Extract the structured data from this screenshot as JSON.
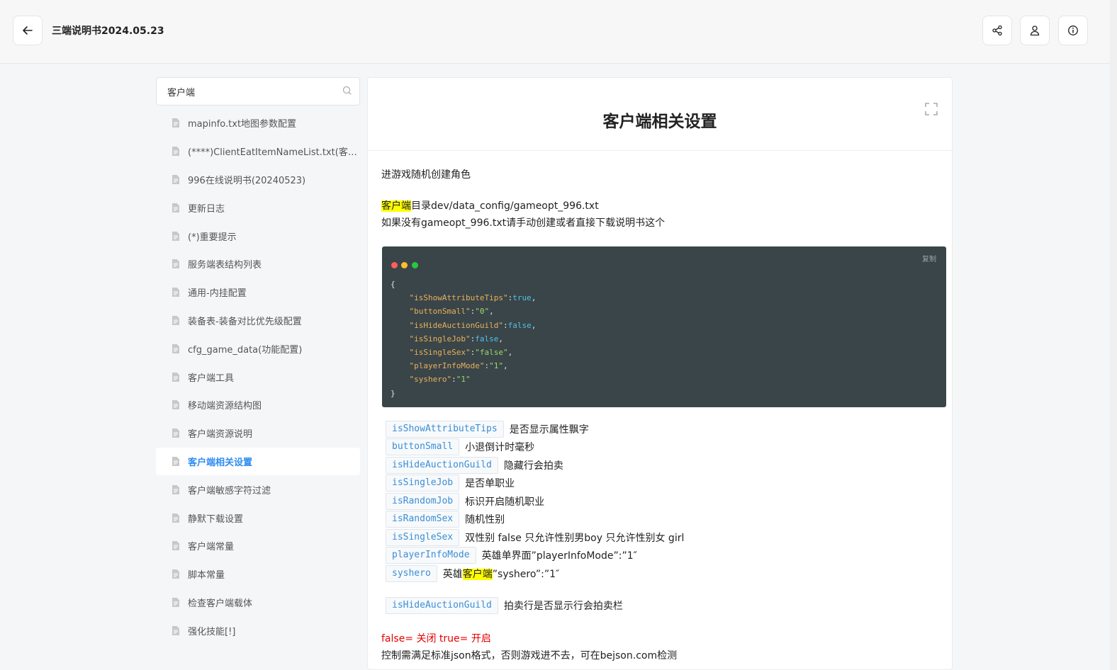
{
  "header": {
    "title": "三端说明书2024.05.23",
    "back_icon": "arrow-left-icon",
    "share_icon": "share-icon",
    "user_icon": "user-icon",
    "info_icon": "info-icon"
  },
  "sidebar": {
    "search_value": "客户端",
    "items": [
      {
        "label": "mapinfo.txt地图参数配置"
      },
      {
        "label": "(****)ClientEatItemNameList.txt(客户端"
      },
      {
        "label": "996在线说明书(20240523)"
      },
      {
        "label": "更新日志"
      },
      {
        "label": "(*)重要提示"
      },
      {
        "label": "服务端表结构列表"
      },
      {
        "label": "通用-内挂配置"
      },
      {
        "label": "装备表-装备对比优先级配置"
      },
      {
        "label": "cfg_game_data(功能配置)"
      },
      {
        "label": "客户端工具"
      },
      {
        "label": "移动端资源结构图"
      },
      {
        "label": "客户端资源说明"
      },
      {
        "label": "客户端相关设置",
        "active": true
      },
      {
        "label": "客户端敏感字符过滤"
      },
      {
        "label": "静默下载设置"
      },
      {
        "label": "客户端常量"
      },
      {
        "label": "脚本常量"
      },
      {
        "label": "检查客户端载体"
      },
      {
        "label": "强化技能[!]"
      }
    ]
  },
  "article": {
    "title": "客户端相关设置",
    "intro": "进游戏随机创建角色",
    "path_highlight": "客户端",
    "path_rest": "目录dev/data_config/gameopt_996.txt",
    "note": "如果没有gameopt_996.txt请手动创建或者直接下载说明书这个",
    "code": {
      "copy_label": "复制",
      "open_brace": "{",
      "close_brace": "}",
      "lines": [
        {
          "key": "\"isShowAttributeTips\"",
          "value": "true",
          "type": "bool"
        },
        {
          "key": "\"buttonSmall\"",
          "value": "\"0\"",
          "type": "str"
        },
        {
          "key": "\"isHideAuctionGuild\"",
          "value": "false",
          "type": "bool"
        },
        {
          "key": "\"isSingleJob\"",
          "value": "false",
          "type": "bool"
        },
        {
          "key": "\"isSingleSex\"",
          "value": "\"false\"",
          "type": "str"
        },
        {
          "key": "\"playerInfoMode\"",
          "value": "\"1\"",
          "type": "str"
        },
        {
          "key": "\"syshero\"",
          "value": "\"1\"",
          "type": "str",
          "last": true
        }
      ]
    },
    "params": [
      {
        "name": "isShowAttributeTips",
        "desc": "是否显示属性飘字"
      },
      {
        "name": "buttonSmall",
        "desc": "小退倒计时毫秒"
      },
      {
        "name": "isHideAuctionGuild",
        "desc": "隐藏行会拍卖"
      },
      {
        "name": "isSingleJob",
        "desc": "是否单职业"
      },
      {
        "name": "isRandomJob",
        "desc": "标识开启随机职业"
      },
      {
        "name": "isRandomSex",
        "desc": "随机性别"
      },
      {
        "name": "isSingleSex",
        "desc": "双性别 false 只允许性别男boy 只允许性别女 girl"
      },
      {
        "name": "playerInfoMode",
        "desc": "英雄单界面”playerInfoMode”:”1″"
      },
      {
        "name": "syshero",
        "desc_pre": "英雄",
        "desc_hl": "客户端",
        "desc_post": "”syshero”:”1″"
      }
    ],
    "extra_param": {
      "name": "isHideAuctionGuild",
      "desc": "拍卖行是否显示行会拍卖栏"
    },
    "bool_note": "false= 关闭 true= 开启",
    "json_note": "控制需满足标准json格式，否则游戏进不去，可在bejson.com检测"
  },
  "colors": {
    "accent": "#2d8cf0",
    "highlight": "#ffff00",
    "code_bg": "#3a4549",
    "dot_red": "#ff5f56",
    "dot_yellow": "#ffbd2e",
    "dot_green": "#27c93f",
    "warning_red": "#e60000"
  }
}
